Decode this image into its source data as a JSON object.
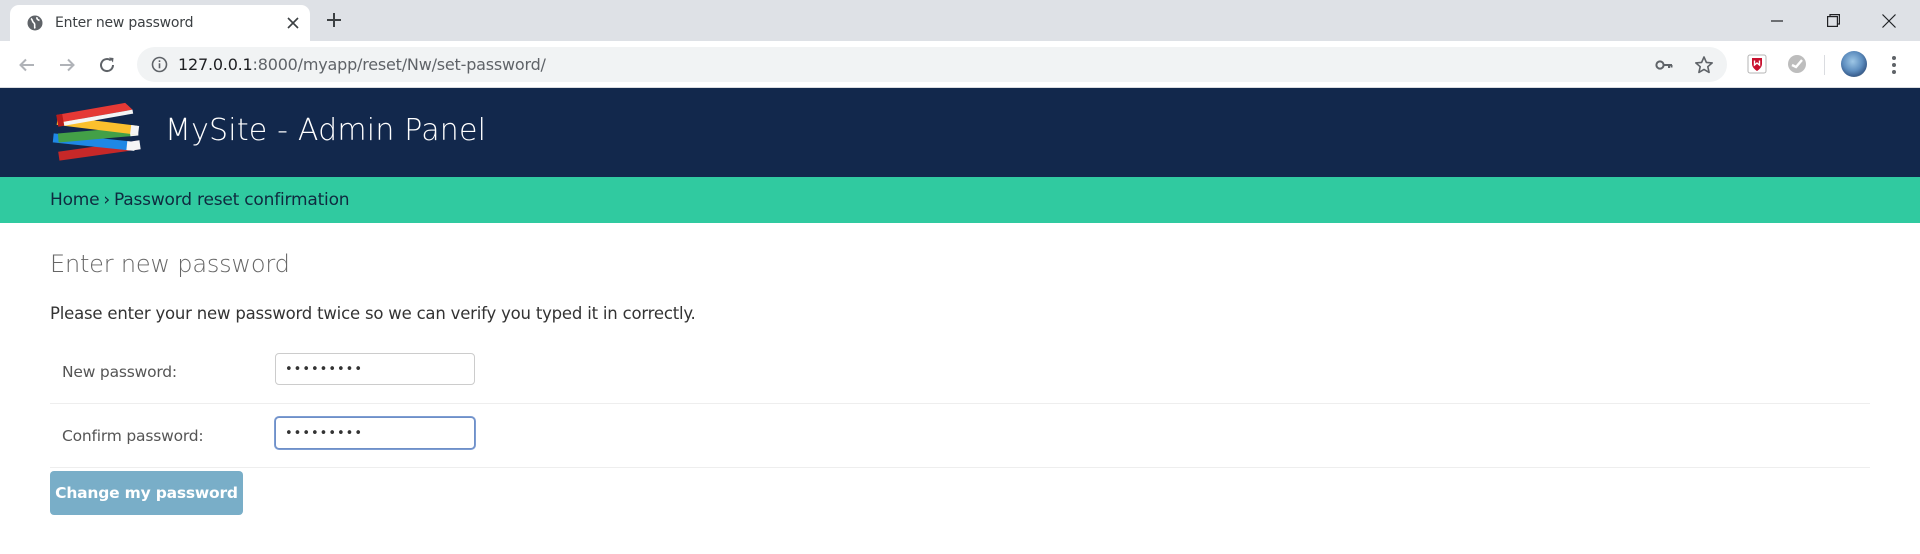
{
  "browser": {
    "tab_title": "Enter new password",
    "url_host": "127.0.0.1",
    "url_rest": ":8000/myapp/reset/Nw/set-password/"
  },
  "site": {
    "title": "MySite - Admin Panel"
  },
  "breadcrumb": {
    "home": "Home",
    "separator": "›",
    "current": "Password reset confirmation"
  },
  "content": {
    "title": "Enter new password",
    "intro": "Please enter your new password twice so we can verify you typed it in correctly."
  },
  "form": {
    "new_password_label": "New password:",
    "new_password_value": "•••••••••",
    "confirm_password_label": "Confirm password:",
    "confirm_password_value": "•••••••••",
    "submit_label": "Change my password"
  },
  "colors": {
    "header_bg": "#12284c",
    "breadcrumb_bg": "#30caa0",
    "button_bg": "#79aec8"
  }
}
